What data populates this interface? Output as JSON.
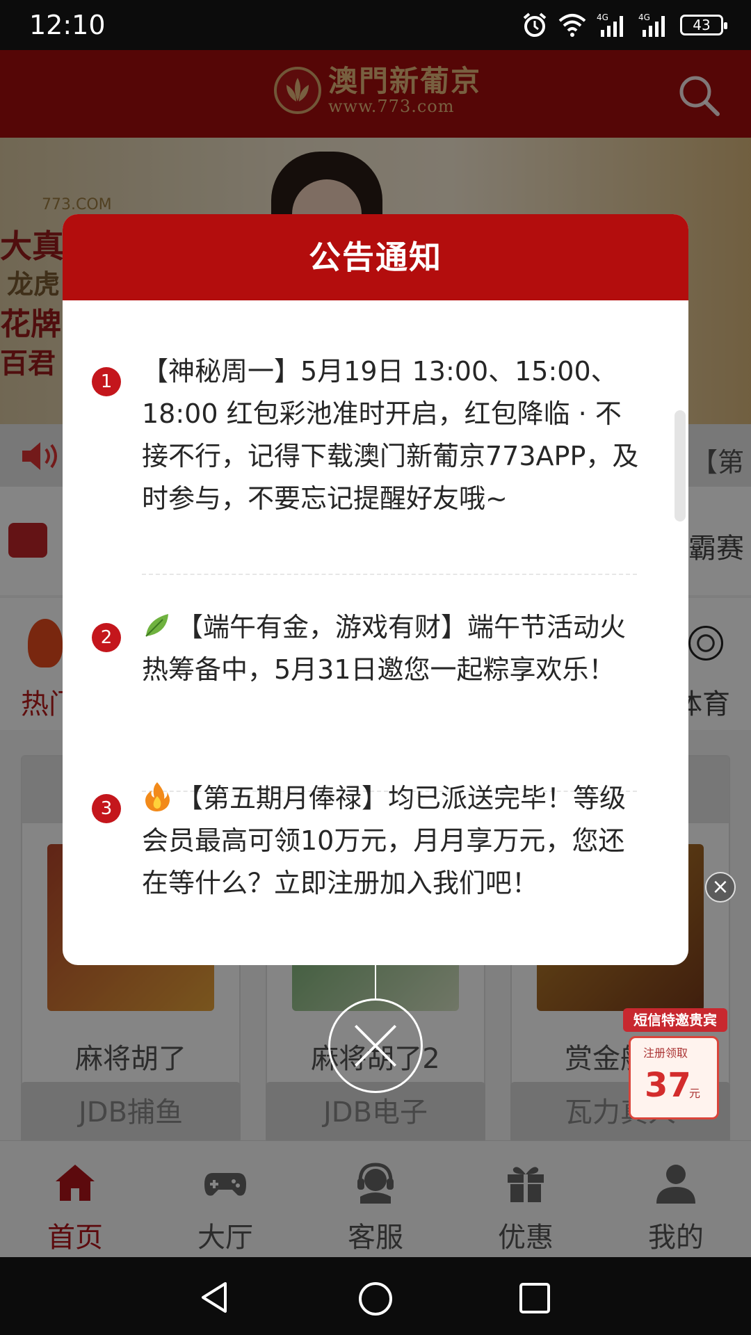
{
  "status_bar": {
    "time": "12:10",
    "battery": "43"
  },
  "header": {
    "logo_cn": "澳門新葡京",
    "logo_url": "www.773.com"
  },
  "background": {
    "banner_site": "773.COM",
    "banner_lines": [
      "大真人",
      "龙虎",
      "花牌",
      "百君"
    ],
    "marquee_text": "【第",
    "wallet_right_text": "霸赛",
    "category_left": "热门",
    "category_right": "体育",
    "games": [
      {
        "name": "麻将胡了"
      },
      {
        "name": "麻将胡了2"
      },
      {
        "name": "赏金船长"
      }
    ],
    "game_buttons": [
      "JDB捕鱼",
      "JDB电子",
      "瓦力真人"
    ]
  },
  "promo": {
    "tag": "短信特邀贵宾",
    "small": "注册领取",
    "amount": "37",
    "unit": "元"
  },
  "modal": {
    "title": "公告通知",
    "notices": [
      {
        "index": "1",
        "emoji": "",
        "text": "【神秘周一】5月19日 13:00、15:00、18:00 红包彩池准时开启，红包降临 · 不接不行，记得下载澳门新葡京773APP，及时参与，不要忘记提醒好友哦~"
      },
      {
        "index": "2",
        "emoji": "leaf",
        "text": "【端午有金，游戏有财】端午节活动火热筹备中，5月31日邀您一起粽享欢乐！"
      },
      {
        "index": "3",
        "emoji": "fire",
        "text": "【第五期月俸禄】均已派送完毕！等级会员最高可领10万元，月月享万元，您还在等什么？立即注册加入我们吧！"
      }
    ]
  },
  "bottom_nav": [
    {
      "label": "首页",
      "icon": "home-icon",
      "active": true
    },
    {
      "label": "大厅",
      "icon": "gamepad-icon",
      "active": false
    },
    {
      "label": "客服",
      "icon": "headset-icon",
      "active": false
    },
    {
      "label": "优惠",
      "icon": "gift-icon",
      "active": false
    },
    {
      "label": "我的",
      "icon": "user-icon",
      "active": false
    }
  ],
  "colors": {
    "brand_red": "#a40d0d",
    "modal_header": "#b30d0d",
    "badge_red": "#c4161c",
    "gold": "#e6b97c"
  }
}
